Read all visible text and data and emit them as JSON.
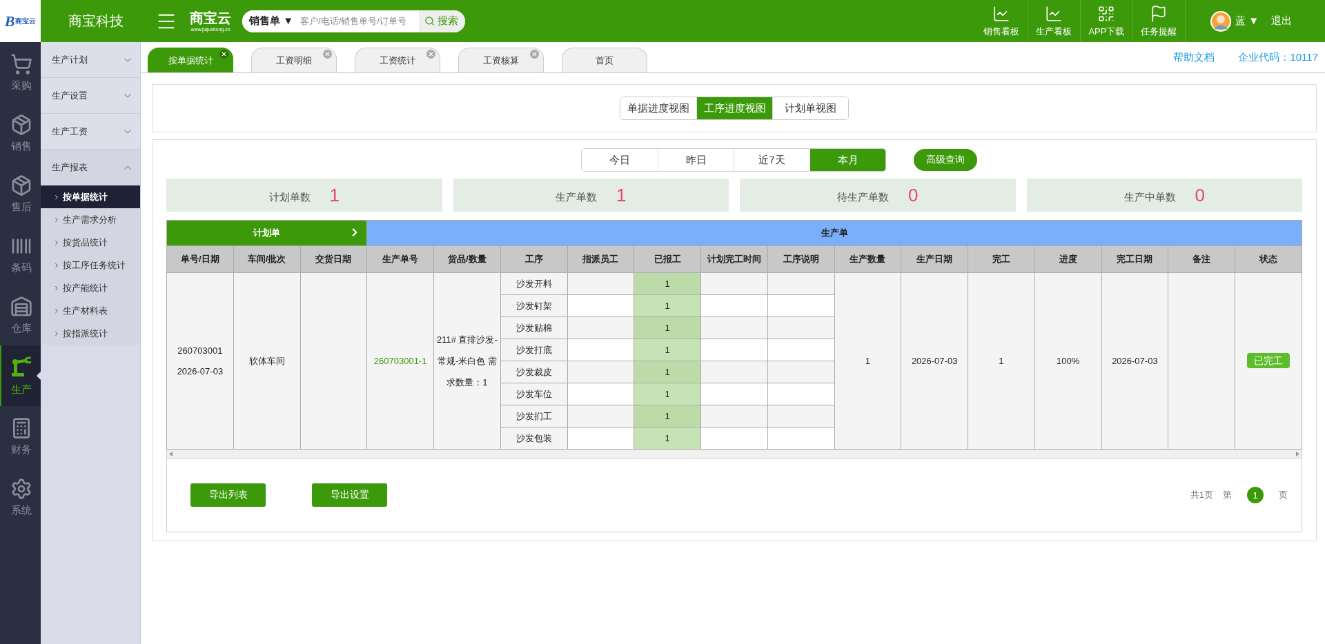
{
  "header": {
    "logo": {
      "mark": "B",
      "name": "商宝云"
    },
    "brand": "商宝科技",
    "product": {
      "name": "商宝云",
      "url": "www.jiajuxitong.cn"
    },
    "search": {
      "type_label": "销售单",
      "caret": "▼",
      "placeholder": "客户/电话/销售单号/订单号",
      "button": "搜索"
    },
    "actions": [
      {
        "label": "销售看板",
        "kind": "chart"
      },
      {
        "label": "生产看板",
        "kind": "chart"
      },
      {
        "label": "APP下载",
        "kind": "qr"
      },
      {
        "label": "任务提醒",
        "kind": "flag"
      }
    ],
    "user": {
      "name": "蓝",
      "caret": "▼",
      "logout": "退出"
    }
  },
  "nav": [
    {
      "label": "采购",
      "kind": "cart",
      "selected": false
    },
    {
      "label": "销售",
      "kind": "boxes",
      "selected": false
    },
    {
      "label": "售后",
      "kind": "boxes",
      "selected": false
    },
    {
      "label": "条码",
      "kind": "barcode",
      "selected": false
    },
    {
      "label": "仓库",
      "kind": "warehouse",
      "selected": false
    },
    {
      "label": "生产",
      "kind": "robot",
      "selected": true
    },
    {
      "label": "财务",
      "kind": "calculator",
      "selected": false
    },
    {
      "label": "系统",
      "kind": "gear",
      "selected": false
    }
  ],
  "sidebar": [
    {
      "label": "生产计划",
      "expanded": false
    },
    {
      "label": "生产设置",
      "expanded": false
    },
    {
      "label": "生产工资",
      "expanded": false
    },
    {
      "label": "生产报表",
      "expanded": true,
      "children": [
        {
          "label": "按单据统计",
          "selected": true
        },
        {
          "label": "生产需求分析",
          "selected": false
        },
        {
          "label": "按货品统计",
          "selected": false
        },
        {
          "label": "按工序任务统计",
          "selected": false
        },
        {
          "label": "按产能统计",
          "selected": false
        },
        {
          "label": "生产材料表",
          "selected": false
        },
        {
          "label": "按指派统计",
          "selected": false
        }
      ]
    }
  ],
  "tabs": [
    {
      "label": "按单据统计",
      "selected": true,
      "closable": true
    },
    {
      "label": "工资明细",
      "selected": false,
      "closable": true
    },
    {
      "label": "工资统计",
      "selected": false,
      "closable": true
    },
    {
      "label": "工资核算",
      "selected": false,
      "closable": true
    },
    {
      "label": "首页",
      "selected": false,
      "closable": false
    }
  ],
  "links": {
    "help": "帮助文档",
    "company": "企业代码：10117"
  },
  "views": [
    {
      "label": "单据进度视图",
      "selected": false
    },
    {
      "label": "工序进度视图",
      "selected": true
    },
    {
      "label": "计划单视图",
      "selected": false
    }
  ],
  "periods": [
    {
      "label": "今日",
      "selected": false
    },
    {
      "label": "昨日",
      "selected": false
    },
    {
      "label": "近7天",
      "selected": false
    },
    {
      "label": "本月",
      "selected": true
    }
  ],
  "advanced_query": "高级查询",
  "stats": [
    {
      "label": "计划单数",
      "value": "1"
    },
    {
      "label": "生产单数",
      "value": "1"
    },
    {
      "label": "待生产单数",
      "value": "0"
    },
    {
      "label": "生产中单数",
      "value": "0"
    }
  ],
  "table": {
    "groups": [
      {
        "label": "计划单",
        "arrow": true,
        "columns": [
          "单号/日期",
          "车间/批次",
          "交货日期"
        ]
      },
      {
        "label": "生产单",
        "arrow": false,
        "columns": [
          "生产单号",
          "货品/数量",
          "工序",
          "指派员工",
          "已报工",
          "计划完工时间",
          "工序说明",
          "生产数量",
          "生产日期",
          "完工",
          "进度",
          "完工日期",
          "备注",
          "状态"
        ]
      }
    ],
    "orders": [
      {
        "order_no": "260703001",
        "date": "2026-07-03",
        "workshop": "软体车间",
        "production_no": "260703001-1",
        "goods": "211# 直排沙发-常规-米白色 需求数量：1",
        "processes": [
          {
            "name": "沙发开料",
            "reported": "1"
          },
          {
            "name": "沙发钉架",
            "reported": "1"
          },
          {
            "name": "沙发贴棉",
            "reported": "1"
          },
          {
            "name": "沙发打底",
            "reported": "1"
          },
          {
            "name": "沙发裁皮",
            "reported": "1"
          },
          {
            "name": "沙发车位",
            "reported": "1"
          },
          {
            "name": "沙发扪工",
            "reported": "1"
          },
          {
            "name": "沙发包装",
            "reported": "1"
          }
        ],
        "quantity": "1",
        "production_date": "2026-07-03",
        "completed": "1",
        "progress": "100%",
        "finish_date": "2026-07-03",
        "status": "已完工"
      }
    ]
  },
  "footer": {
    "buttons": [
      "导出列表",
      "导出设置"
    ],
    "pagination": {
      "total": "共1页",
      "prefix": "第",
      "pages": [
        {
          "label": "1",
          "selected": true
        }
      ],
      "suffix": "页"
    }
  }
}
